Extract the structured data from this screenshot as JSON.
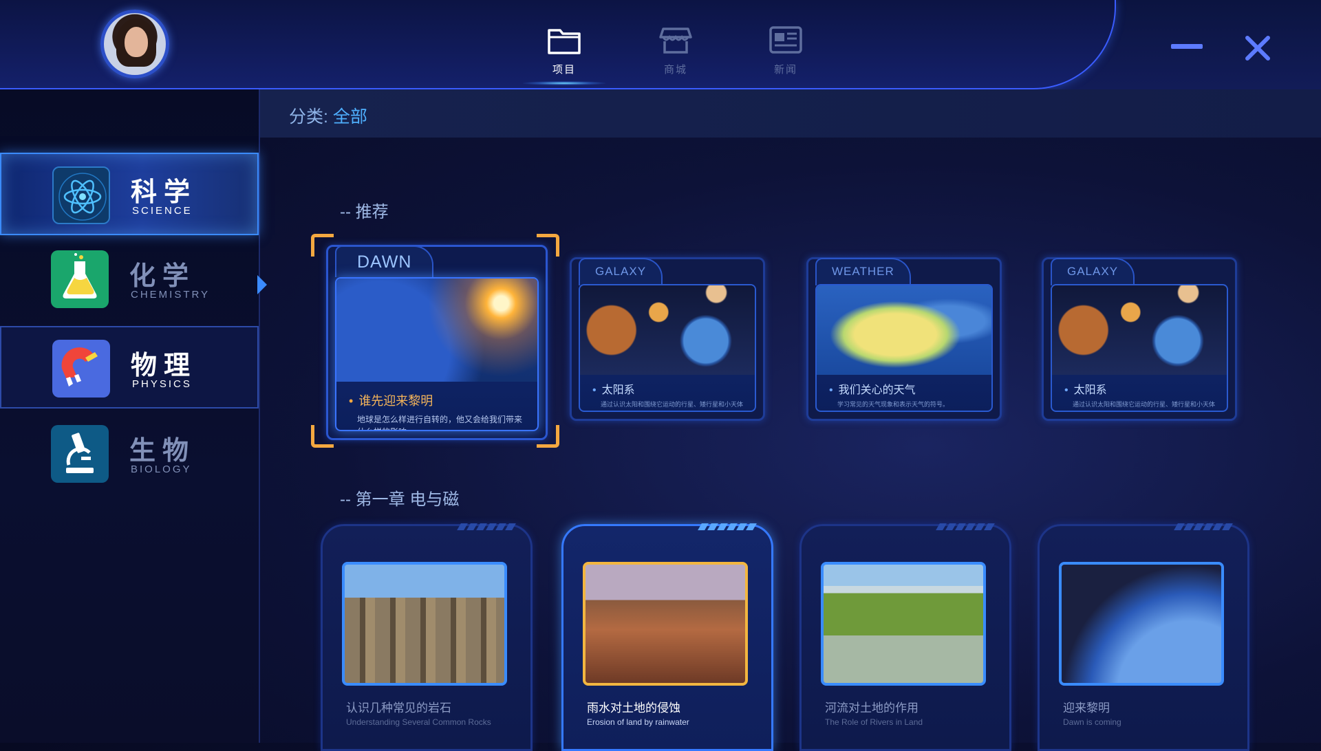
{
  "header": {
    "nav": [
      {
        "label": "项目",
        "icon": "folder-icon",
        "active": true
      },
      {
        "label": "商城",
        "icon": "store-icon",
        "active": false
      },
      {
        "label": "新闻",
        "icon": "news-icon",
        "active": false
      }
    ],
    "window_controls": {
      "minimize_icon": "minimize-icon",
      "close_icon": "close-icon"
    }
  },
  "sidebar": {
    "items": [
      {
        "zh": "科学",
        "en": "SCIENCE",
        "icon": "atom-icon",
        "state": "active"
      },
      {
        "zh": "化学",
        "en": "CHEMISTRY",
        "icon": "flask-icon",
        "state": "dim"
      },
      {
        "zh": "物理",
        "en": "PHYSICS",
        "icon": "magnet-icon",
        "state": "bordered"
      },
      {
        "zh": "生物",
        "en": "BIOLOGY",
        "icon": "microscope-icon",
        "state": "dim"
      }
    ]
  },
  "filter": {
    "label": "分类:",
    "value": "全部"
  },
  "recommend": {
    "title": "-- 推荐",
    "cards": [
      {
        "tag": "DAWN",
        "title": "谁先迎来黎明",
        "desc": "地球是怎么样进行自转的，他又会给我们带来什么样的影响。",
        "featured": true
      },
      {
        "tag": "GALAXY",
        "title": "太阳系",
        "desc": "通过认识太阳和围绕它运动的行星、矮行星和小天体组成了太阳系的相关模型。",
        "featured": false
      },
      {
        "tag": "WEATHER",
        "title": "我们关心的天气",
        "desc": "学习常见的天气现象和表示天气的符号。",
        "featured": false
      },
      {
        "tag": "GALAXY",
        "title": "太阳系",
        "desc": "通过认识太阳和围绕它运动的行星、矮行星和小天体组成了太阳系的相关模型。",
        "featured": false
      }
    ]
  },
  "chapter": {
    "title": "-- 第一章 电与磁",
    "cards": [
      {
        "zh": "认识几种常见的岩石",
        "en": "Understanding Several Common Rocks",
        "active": false
      },
      {
        "zh": "雨水对土地的侵蚀",
        "en": "Erosion of land by rainwater",
        "active": true
      },
      {
        "zh": "河流对土地的作用",
        "en": "The Role of Rivers in Land",
        "active": false
      },
      {
        "zh": "迎来黎明",
        "en": "Dawn is coming",
        "active": false
      }
    ]
  },
  "colors": {
    "accent": "#3b8bff",
    "highlight": "#f4a840",
    "background": "#0d1238"
  }
}
